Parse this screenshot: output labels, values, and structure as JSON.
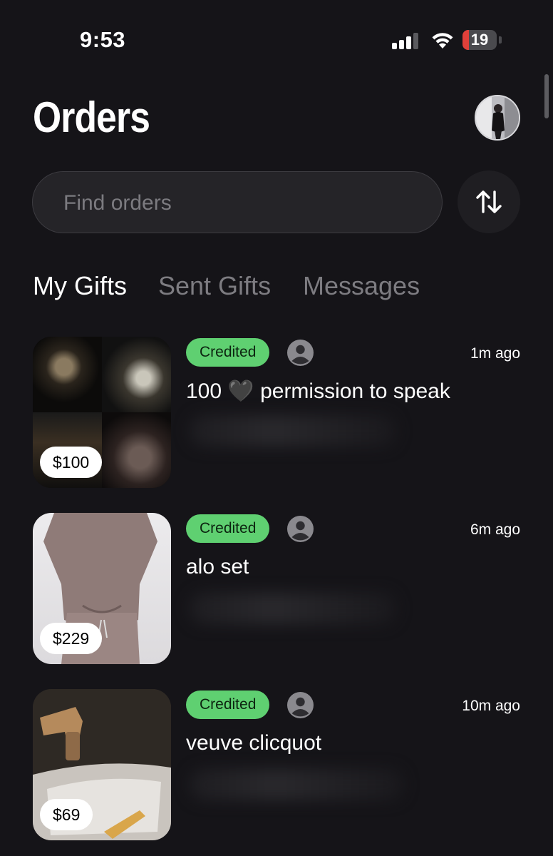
{
  "status_bar": {
    "time": "9:53",
    "battery": "19",
    "battery_level": 0.19,
    "signal_bars_active": 3,
    "signal_bars_total": 4
  },
  "header": {
    "title": "Orders"
  },
  "search": {
    "placeholder": "Find orders"
  },
  "tabs": [
    {
      "label": "My Gifts",
      "active": true
    },
    {
      "label": "Sent Gifts",
      "active": false
    },
    {
      "label": "Messages",
      "active": false
    }
  ],
  "orders": [
    {
      "price": "$100",
      "status": "Credited",
      "time": "1m ago",
      "title": "100 🖤 permission to speak"
    },
    {
      "price": "$229",
      "status": "Credited",
      "time": "6m ago",
      "title": "alo set"
    },
    {
      "price": "$69",
      "status": "Credited",
      "time": "10m ago",
      "title": "veuve clicquot"
    }
  ],
  "colors": {
    "background": "#151418",
    "badge_green": "#5fd071",
    "inactive_tab": "#7d7c81",
    "battery_low": "#e0403a"
  },
  "icons": {
    "sort": "sort-arrows-icon",
    "user": "user-icon",
    "wifi": "wifi-icon",
    "signal": "signal-icon",
    "battery": "battery-icon"
  }
}
